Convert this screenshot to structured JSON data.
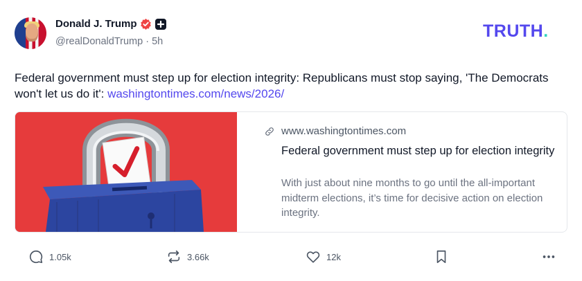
{
  "author": {
    "display_name": "Donald J. Trump",
    "handle_line": "@realDonaldTrump · 5h",
    "verified_color": "#ef4444"
  },
  "brand": {
    "logo_text": "TRUTH",
    "logo_dot": ".",
    "color": "#5448ee",
    "dot_color": "#33d3c0"
  },
  "post": {
    "text": "Federal government must step up for election integrity: Republicans must stop saying, 'The Democrats won't let us do it': ",
    "link_text": "washingtontimes.com/news/2026/"
  },
  "card": {
    "domain": "www.washingtontimes.com",
    "title": "Federal government must step up for election integrity",
    "description": "With just about nine months to go until the all-important midterm elections, it’s time for decisive action on election integrity.",
    "image_icon": "padlock-ballot-box-icon"
  },
  "actions": {
    "reply_count": "1.05k",
    "retruth_count": "3.66k",
    "like_count": "12k"
  }
}
